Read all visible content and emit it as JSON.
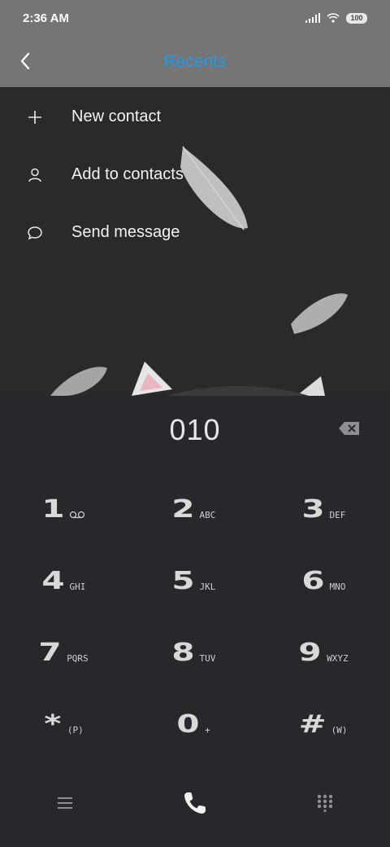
{
  "status_bar": {
    "time": "2:36 AM",
    "battery": "100"
  },
  "header": {
    "title": "Recents",
    "back_icon": "chevron-left-icon"
  },
  "menu": [
    {
      "label": "New contact",
      "icon": "plus-icon"
    },
    {
      "label": "Add to contacts",
      "icon": "person-icon"
    },
    {
      "label": "Send message",
      "icon": "chat-bubble-icon"
    }
  ],
  "dialpad": {
    "number": "010",
    "keys": [
      {
        "digit": "1",
        "letters": ""
      },
      {
        "digit": "2",
        "letters": "ABC"
      },
      {
        "digit": "3",
        "letters": "DEF"
      },
      {
        "digit": "4",
        "letters": "GHI"
      },
      {
        "digit": "5",
        "letters": "JKL"
      },
      {
        "digit": "6",
        "letters": "MNO"
      },
      {
        "digit": "7",
        "letters": "PQRS"
      },
      {
        "digit": "8",
        "letters": "TUV"
      },
      {
        "digit": "9",
        "letters": "WXYZ"
      },
      {
        "digit": "*",
        "letters": "(P)"
      },
      {
        "digit": "0",
        "letters": "+"
      },
      {
        "digit": "#",
        "letters": "(W)"
      }
    ]
  },
  "bottom_bar": {
    "left_icon": "menu-icon",
    "center_icon": "phone-icon",
    "right_icon": "dialpad-icon"
  },
  "colors": {
    "accent": "#1e9bf0",
    "header_bg": "#757575",
    "dialpad_bg": "#26282b"
  }
}
